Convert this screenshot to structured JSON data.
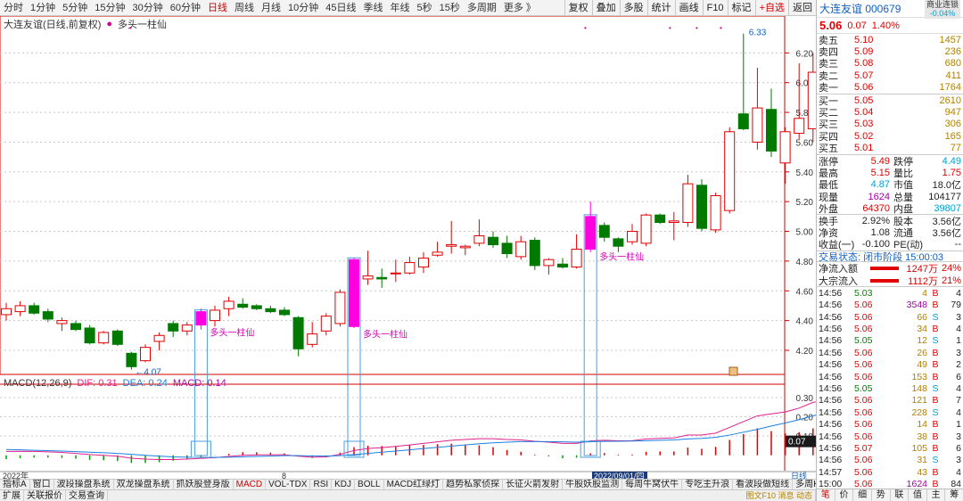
{
  "toolbar": {
    "periods": [
      "分时",
      "1分钟",
      "5分钟",
      "15分钟",
      "30分钟",
      "60分钟",
      "日线",
      "周线",
      "月线",
      "10分钟",
      "45日线",
      "季线",
      "年线",
      "5秒",
      "15秒",
      "多周期",
      "更多 》"
    ],
    "active_period": "日线",
    "tools": [
      "复权",
      "叠加",
      "多股",
      "统计",
      "画线",
      "F10",
      "标记",
      "+自选",
      "返回"
    ]
  },
  "chart_header": {
    "title": "大连友谊(日线,前复权)",
    "indicator": "多头一柱仙"
  },
  "chart_data": {
    "type": "candlestick",
    "y_ticks": [
      "6.20",
      "6.00",
      "5.80",
      "5.60",
      "5.40",
      "5.20",
      "5.00",
      "4.80",
      "4.60",
      "4.40",
      "4.20"
    ],
    "ylim": [
      4.05,
      6.4
    ],
    "candles": [
      {
        "o": 4.44,
        "h": 4.52,
        "l": 4.4,
        "c": 4.48
      },
      {
        "o": 4.46,
        "h": 4.53,
        "l": 4.43,
        "c": 4.5
      },
      {
        "o": 4.5,
        "h": 4.52,
        "l": 4.44,
        "c": 4.45
      },
      {
        "o": 4.46,
        "h": 4.48,
        "l": 4.39,
        "c": 4.41
      },
      {
        "o": 4.38,
        "h": 4.42,
        "l": 4.33,
        "c": 4.4
      },
      {
        "o": 4.38,
        "h": 4.4,
        "l": 4.33,
        "c": 4.34
      },
      {
        "o": 4.35,
        "h": 4.37,
        "l": 4.24,
        "c": 4.25
      },
      {
        "o": 4.25,
        "h": 4.33,
        "l": 4.24,
        "c": 4.32
      },
      {
        "o": 4.33,
        "h": 4.34,
        "l": 4.23,
        "c": 4.24
      },
      {
        "o": 4.18,
        "h": 4.19,
        "l": 4.07,
        "c": 4.09
      },
      {
        "o": 4.13,
        "h": 4.24,
        "l": 4.12,
        "c": 4.22
      },
      {
        "o": 4.26,
        "h": 4.32,
        "l": 4.2,
        "c": 4.3
      },
      {
        "o": 4.38,
        "h": 4.4,
        "l": 4.29,
        "c": 4.33
      },
      {
        "o": 4.33,
        "h": 4.39,
        "l": 4.3,
        "c": 4.37
      },
      {
        "o": 4.37,
        "h": 4.48,
        "l": 4.34,
        "c": 4.46
      },
      {
        "o": 4.4,
        "h": 4.5,
        "l": 4.36,
        "c": 4.47
      },
      {
        "o": 4.48,
        "h": 4.56,
        "l": 4.43,
        "c": 4.53
      },
      {
        "o": 4.51,
        "h": 4.55,
        "l": 4.48,
        "c": 4.49
      },
      {
        "o": 4.5,
        "h": 4.51,
        "l": 4.47,
        "c": 4.48
      },
      {
        "o": 4.48,
        "h": 4.5,
        "l": 4.45,
        "c": 4.46
      },
      {
        "o": 4.47,
        "h": 4.49,
        "l": 4.43,
        "c": 4.44
      },
      {
        "o": 4.42,
        "h": 4.43,
        "l": 4.16,
        "c": 4.21
      },
      {
        "o": 4.24,
        "h": 4.39,
        "l": 4.22,
        "c": 4.31
      },
      {
        "o": 4.33,
        "h": 4.45,
        "l": 4.3,
        "c": 4.43
      },
      {
        "o": 4.38,
        "h": 4.61,
        "l": 4.36,
        "c": 4.59
      },
      {
        "o": 4.36,
        "h": 4.82,
        "l": 4.35,
        "c": 4.81
      },
      {
        "o": 4.68,
        "h": 4.87,
        "l": 4.64,
        "c": 4.7
      },
      {
        "o": 4.69,
        "h": 4.75,
        "l": 4.62,
        "c": 4.68
      },
      {
        "o": 4.72,
        "h": 4.81,
        "l": 4.66,
        "c": 4.72
      },
      {
        "o": 4.72,
        "h": 4.83,
        "l": 4.71,
        "c": 4.79
      },
      {
        "o": 4.76,
        "h": 4.86,
        "l": 4.72,
        "c": 4.82
      },
      {
        "o": 4.84,
        "h": 4.93,
        "l": 4.83,
        "c": 4.86
      },
      {
        "o": 4.9,
        "h": 5.07,
        "l": 4.85,
        "c": 4.91
      },
      {
        "o": 4.89,
        "h": 4.91,
        "l": 4.84,
        "c": 4.9
      },
      {
        "o": 4.92,
        "h": 5.08,
        "l": 4.9,
        "c": 4.97
      },
      {
        "o": 4.96,
        "h": 5.0,
        "l": 4.89,
        "c": 4.91
      },
      {
        "o": 4.92,
        "h": 4.97,
        "l": 4.82,
        "c": 4.85
      },
      {
        "o": 4.83,
        "h": 4.97,
        "l": 4.81,
        "c": 4.93
      },
      {
        "o": 4.94,
        "h": 4.96,
        "l": 4.74,
        "c": 4.77
      },
      {
        "o": 4.77,
        "h": 4.82,
        "l": 4.71,
        "c": 4.81
      },
      {
        "o": 4.78,
        "h": 4.82,
        "l": 4.75,
        "c": 4.76
      },
      {
        "o": 4.76,
        "h": 4.98,
        "l": 4.75,
        "c": 4.88
      },
      {
        "o": 4.88,
        "h": 5.2,
        "l": 4.86,
        "c": 5.1
      },
      {
        "o": 5.04,
        "h": 5.06,
        "l": 4.93,
        "c": 4.96
      },
      {
        "o": 4.95,
        "h": 4.96,
        "l": 4.86,
        "c": 4.9
      },
      {
        "o": 4.93,
        "h": 5.05,
        "l": 4.91,
        "c": 5.0
      },
      {
        "o": 4.92,
        "h": 5.12,
        "l": 4.9,
        "c": 5.11
      },
      {
        "o": 5.11,
        "h": 5.12,
        "l": 5.05,
        "c": 5.06
      },
      {
        "o": 5.06,
        "h": 5.13,
        "l": 4.94,
        "c": 5.07
      },
      {
        "o": 5.06,
        "h": 5.38,
        "l": 5.03,
        "c": 5.32
      },
      {
        "o": 5.31,
        "h": 5.35,
        "l": 5.0,
        "c": 5.02
      },
      {
        "o": 5.01,
        "h": 5.26,
        "l": 4.99,
        "c": 5.24
      },
      {
        "o": 5.14,
        "h": 5.7,
        "l": 5.12,
        "c": 5.67
      },
      {
        "o": 5.79,
        "h": 6.33,
        "l": 5.68,
        "c": 5.69
      },
      {
        "o": 5.6,
        "h": 6.1,
        "l": 5.55,
        "c": 5.83
      },
      {
        "o": 5.82,
        "h": 5.96,
        "l": 5.5,
        "c": 5.54
      },
      {
        "o": 5.46,
        "h": 5.7,
        "l": 5.32,
        "c": 5.67
      },
      {
        "o": 5.66,
        "h": 6.13,
        "l": 5.62,
        "c": 5.76
      },
      {
        "o": 5.69,
        "h": 6.2,
        "l": 5.6,
        "c": 6.07
      },
      {
        "o": 5.75,
        "h": 5.98,
        "l": 5.64,
        "c": 5.89
      }
    ],
    "signals": [
      {
        "index": 14,
        "label": "多头一柱仙"
      },
      {
        "index": 25,
        "label": "多头一柱仙"
      },
      {
        "index": 42,
        "label": "多头一柱仙"
      }
    ],
    "annotations": [
      {
        "index": 9,
        "price": 4.07,
        "label": "4.07"
      },
      {
        "index": 53,
        "price": 6.33,
        "label": "6.33"
      }
    ],
    "macd": {
      "header": "MACD(12,26,9)",
      "dif_label": "DIF: 0.31",
      "dea_label": "DEA: 0.24",
      "macd_label": "MACD: 0.14",
      "y_ticks": [
        "0.30",
        "0.20",
        "0.10"
      ],
      "current_label": "0.07",
      "ylim": [
        -0.08,
        0.36
      ],
      "dif": [
        0.02,
        0.021,
        0.02,
        0.018,
        0.015,
        0.01,
        0.004,
        0.0,
        -0.005,
        -0.015,
        -0.02,
        -0.022,
        -0.022,
        -0.02,
        -0.016,
        -0.012,
        -0.006,
        0.0,
        0.002,
        0.003,
        0.003,
        -0.005,
        -0.01,
        -0.008,
        0.005,
        0.025,
        0.035,
        0.04,
        0.046,
        0.054,
        0.062,
        0.07,
        0.078,
        0.082,
        0.086,
        0.086,
        0.082,
        0.08,
        0.073,
        0.068,
        0.062,
        0.062,
        0.075,
        0.078,
        0.075,
        0.076,
        0.085,
        0.088,
        0.09,
        0.105,
        0.105,
        0.115,
        0.145,
        0.175,
        0.205,
        0.215,
        0.225,
        0.245,
        0.275,
        0.285
      ],
      "dea": [
        0.03,
        0.028,
        0.026,
        0.024,
        0.022,
        0.019,
        0.016,
        0.013,
        0.01,
        0.005,
        0.0,
        -0.004,
        -0.008,
        -0.01,
        -0.011,
        -0.011,
        -0.01,
        -0.008,
        -0.006,
        -0.004,
        -0.002,
        -0.002,
        -0.003,
        -0.004,
        -0.002,
        0.004,
        0.01,
        0.016,
        0.022,
        0.028,
        0.035,
        0.041,
        0.048,
        0.054,
        0.06,
        0.065,
        0.068,
        0.071,
        0.071,
        0.071,
        0.07,
        0.068,
        0.07,
        0.072,
        0.073,
        0.074,
        0.076,
        0.078,
        0.08,
        0.085,
        0.088,
        0.093,
        0.105,
        0.12,
        0.135,
        0.152,
        0.168,
        0.185,
        0.205,
        0.225
      ],
      "hist": [
        -0.02,
        -0.015,
        -0.012,
        -0.012,
        -0.014,
        -0.018,
        -0.024,
        -0.026,
        -0.03,
        -0.04,
        -0.04,
        -0.036,
        -0.028,
        -0.02,
        -0.01,
        -0.002,
        0.008,
        0.016,
        0.016,
        0.014,
        0.01,
        -0.006,
        -0.014,
        -0.008,
        0.014,
        0.042,
        0.05,
        0.048,
        0.048,
        0.052,
        0.054,
        0.058,
        0.06,
        0.056,
        0.052,
        0.042,
        0.028,
        0.018,
        0.004,
        -0.006,
        -0.016,
        -0.012,
        0.01,
        0.012,
        0.004,
        0.004,
        0.018,
        0.02,
        0.02,
        0.04,
        0.034,
        0.044,
        0.08,
        0.11,
        0.14,
        0.126,
        0.114,
        0.12,
        0.14,
        0.12
      ]
    },
    "time_labels": [
      "2022年",
      "8",
      "2022/09/01/四"
    ],
    "grid": "dashed horizontal"
  },
  "bottom_tabs": [
    "指标A",
    "窗口",
    "波段操盘系统",
    "双龙操盘系统",
    "抓妖股登身版",
    "MACD",
    "VOL-TDX",
    "RSI",
    "KDJ",
    "BOLL",
    "MACD红绿灯",
    "趋势私家侦探",
    "长征火箭发射",
    "牛股妖股监测",
    "每周牛窝伏牛",
    "专吃主升浪",
    "看波段做短线",
    "多周KDRM",
    "》",
    "指标B",
    "模板",
    "▲"
  ],
  "bottom_active_tab": "MACD",
  "bottom_tabs2": [
    "扩展",
    "关联报价",
    "交易查询"
  ],
  "bottom_right_label": "日线",
  "bottom_right_label2": "图文F10  消息  动态",
  "quote": {
    "name": "大连友谊 000679",
    "sector": "商业连锁",
    "sector_change": "-0.04%",
    "price": "5.06",
    "change": "0.07",
    "change_pct": "1.40%",
    "asks": [
      {
        "label": "卖五",
        "price": "5.10",
        "vol": "1457"
      },
      {
        "label": "卖四",
        "price": "5.09",
        "vol": "236"
      },
      {
        "label": "卖三",
        "price": "5.08",
        "vol": "680"
      },
      {
        "label": "卖二",
        "price": "5.07",
        "vol": "411"
      },
      {
        "label": "卖一",
        "price": "5.06",
        "vol": "1764"
      }
    ],
    "bids": [
      {
        "label": "买一",
        "price": "5.05",
        "vol": "2610"
      },
      {
        "label": "买二",
        "price": "5.04",
        "vol": "947"
      },
      {
        "label": "买三",
        "price": "5.03",
        "vol": "306"
      },
      {
        "label": "买四",
        "price": "5.02",
        "vol": "165"
      },
      {
        "label": "买五",
        "price": "5.01",
        "vol": "77"
      }
    ],
    "stats": [
      {
        "l1": "涨停",
        "v1": "5.49",
        "c1": "red",
        "l2": "跌停",
        "v2": "4.49",
        "c2": "cyan"
      },
      {
        "l1": "最高",
        "v1": "5.15",
        "c1": "red",
        "l2": "量比",
        "v2": "1.75",
        "c2": "red"
      },
      {
        "l1": "最低",
        "v1": "4.87",
        "c1": "cyan",
        "l2": "市值",
        "v2": "18.0亿",
        "c2": "dark"
      },
      {
        "l1": "现量",
        "v1": "1624",
        "c1": "purple",
        "l2": "总量",
        "v2": "104177",
        "c2": "dark"
      },
      {
        "l1": "外盘",
        "v1": "64370",
        "c1": "red",
        "l2": "内盘",
        "v2": "39807",
        "c2": "cyan"
      },
      {
        "l1": "换手",
        "v1": "2.92%",
        "c1": "dark",
        "l2": "股本",
        "v2": "3.56亿",
        "c2": "dark"
      },
      {
        "l1": "净资",
        "v1": "1.08",
        "c1": "dark",
        "l2": "流通",
        "v2": "3.56亿",
        "c2": "dark"
      },
      {
        "l1": "收益(一)",
        "v1": "-0.100",
        "c1": "dark",
        "l2": "PE(动)",
        "v2": "--",
        "c2": "dark"
      }
    ],
    "trade_status": "交易状态: 闭市阶段 15:00:03",
    "flows": [
      {
        "label": "净流入额",
        "value": "1247万",
        "pct": "24%"
      },
      {
        "label": "大宗流入",
        "value": "1112万",
        "pct": "21%"
      }
    ],
    "ticks": [
      {
        "t": "14:56",
        "p": "5.03",
        "v": "4",
        "bs": "B",
        "n": "4"
      },
      {
        "t": "14:56",
        "p": "5.06",
        "v": "3548",
        "bs": "B",
        "n": "79"
      },
      {
        "t": "14:56",
        "p": "5.06",
        "v": "66",
        "bs": "S",
        "n": "3"
      },
      {
        "t": "14:56",
        "p": "5.06",
        "v": "34",
        "bs": "B",
        "n": "4"
      },
      {
        "t": "14:56",
        "p": "5.05",
        "v": "12",
        "bs": "S",
        "n": "1"
      },
      {
        "t": "14:56",
        "p": "5.06",
        "v": "26",
        "bs": "B",
        "n": "3"
      },
      {
        "t": "14:56",
        "p": "5.06",
        "v": "49",
        "bs": "B",
        "n": "2"
      },
      {
        "t": "14:56",
        "p": "5.06",
        "v": "153",
        "bs": "B",
        "n": "6"
      },
      {
        "t": "14:56",
        "p": "5.05",
        "v": "148",
        "bs": "S",
        "n": "4"
      },
      {
        "t": "14:56",
        "p": "5.06",
        "v": "121",
        "bs": "B",
        "n": "7"
      },
      {
        "t": "14:56",
        "p": "5.06",
        "v": "228",
        "bs": "S",
        "n": "4"
      },
      {
        "t": "14:56",
        "p": "5.06",
        "v": "14",
        "bs": "B",
        "n": "1"
      },
      {
        "t": "14:56",
        "p": "5.06",
        "v": "38",
        "bs": "B",
        "n": "3"
      },
      {
        "t": "14:56",
        "p": "5.07",
        "v": "105",
        "bs": "B",
        "n": "6"
      },
      {
        "t": "14:56",
        "p": "5.06",
        "v": "31",
        "bs": "S",
        "n": "3"
      },
      {
        "t": "14:57",
        "p": "5.06",
        "v": "43",
        "bs": "B",
        "n": "4"
      },
      {
        "t": "15:00",
        "p": "5.06",
        "v": "1624",
        "bs": "B",
        "n": "84"
      }
    ],
    "footer": [
      "笔",
      "价",
      "细",
      "势",
      "联",
      "值",
      "主",
      "筹"
    ],
    "footer_active": "笔"
  },
  "colors": {
    "up": "#e00000",
    "down": "#007a00",
    "signal": "#ff00e0",
    "dif": "#e0208c",
    "dea": "#1a7fe0",
    "box": "#4a9fe0"
  }
}
